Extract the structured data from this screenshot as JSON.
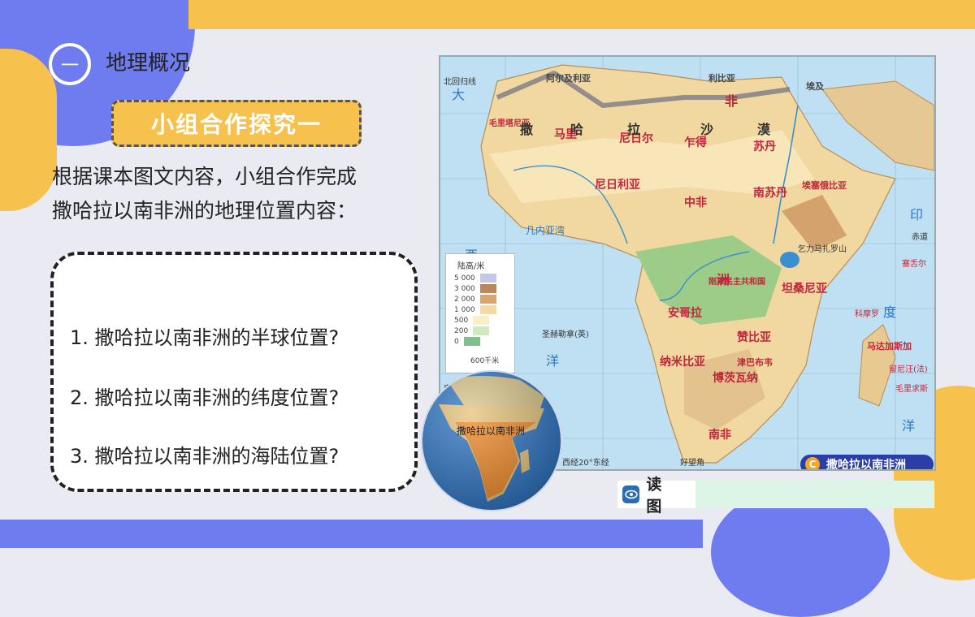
{
  "section": {
    "number": "一",
    "title": "地理概况"
  },
  "group": {
    "label": "小组合作探究一"
  },
  "intro": {
    "line1": "根据课本图文内容，小组合作完成",
    "line2": "撒哈拉以南非洲的地理位置内容："
  },
  "questions": [
    "1. 撒哈拉以南非洲的半球位置?",
    "2. 撒哈拉以南非洲的纬度位置?",
    "3. 撒哈拉以南非洲的海陆位置?"
  ],
  "map": {
    "caption_letter": "C",
    "caption": "撒哈拉以南非洲",
    "seas": [
      "大",
      "西",
      "洋",
      "印",
      "度",
      "洋",
      "几内亚湾"
    ],
    "countries": [
      "毛里塔尼亚",
      "马里",
      "尼日尔",
      "乍得",
      "苏丹",
      "南苏丹",
      "埃塞俄比亚",
      "尼日利亚",
      "中非",
      "刚果民主共和国",
      "安哥拉",
      "纳米比亚",
      "博茨瓦纳",
      "南非",
      "坦桑尼亚",
      "马达加斯加",
      "阿尔及利亚",
      "利比亚",
      "埃及",
      "撒",
      "哈",
      "拉",
      "沙",
      "漠",
      "非",
      "洲",
      "赞比亚",
      "津巴布韦"
    ],
    "labels": [
      "北回归线",
      "赤道",
      "南回归线",
      "西经20°东经",
      "好望角",
      "圣赫勒拿(英)",
      "科摩罗",
      "塞舌尔",
      "留尼汪(法)",
      "毛里求斯",
      "乞力马扎罗山"
    ],
    "legend": {
      "title": "陆高/米",
      "levels": [
        "5 000",
        "3 000",
        "2 000",
        "1 000",
        "500",
        "200",
        "0"
      ],
      "colors": [
        "#c6c6e6",
        "#b9875a",
        "#d8a56e",
        "#f3d9a4",
        "#fbeec6",
        "#cfe8c0",
        "#7fc18c"
      ],
      "scale": "600千米"
    }
  },
  "globe": {
    "label": "撒哈拉以南非洲"
  },
  "read": {
    "label": "读 图"
  },
  "colors": {
    "accent_blue": "#6f7cf0",
    "accent_yellow": "#f6c14d"
  }
}
